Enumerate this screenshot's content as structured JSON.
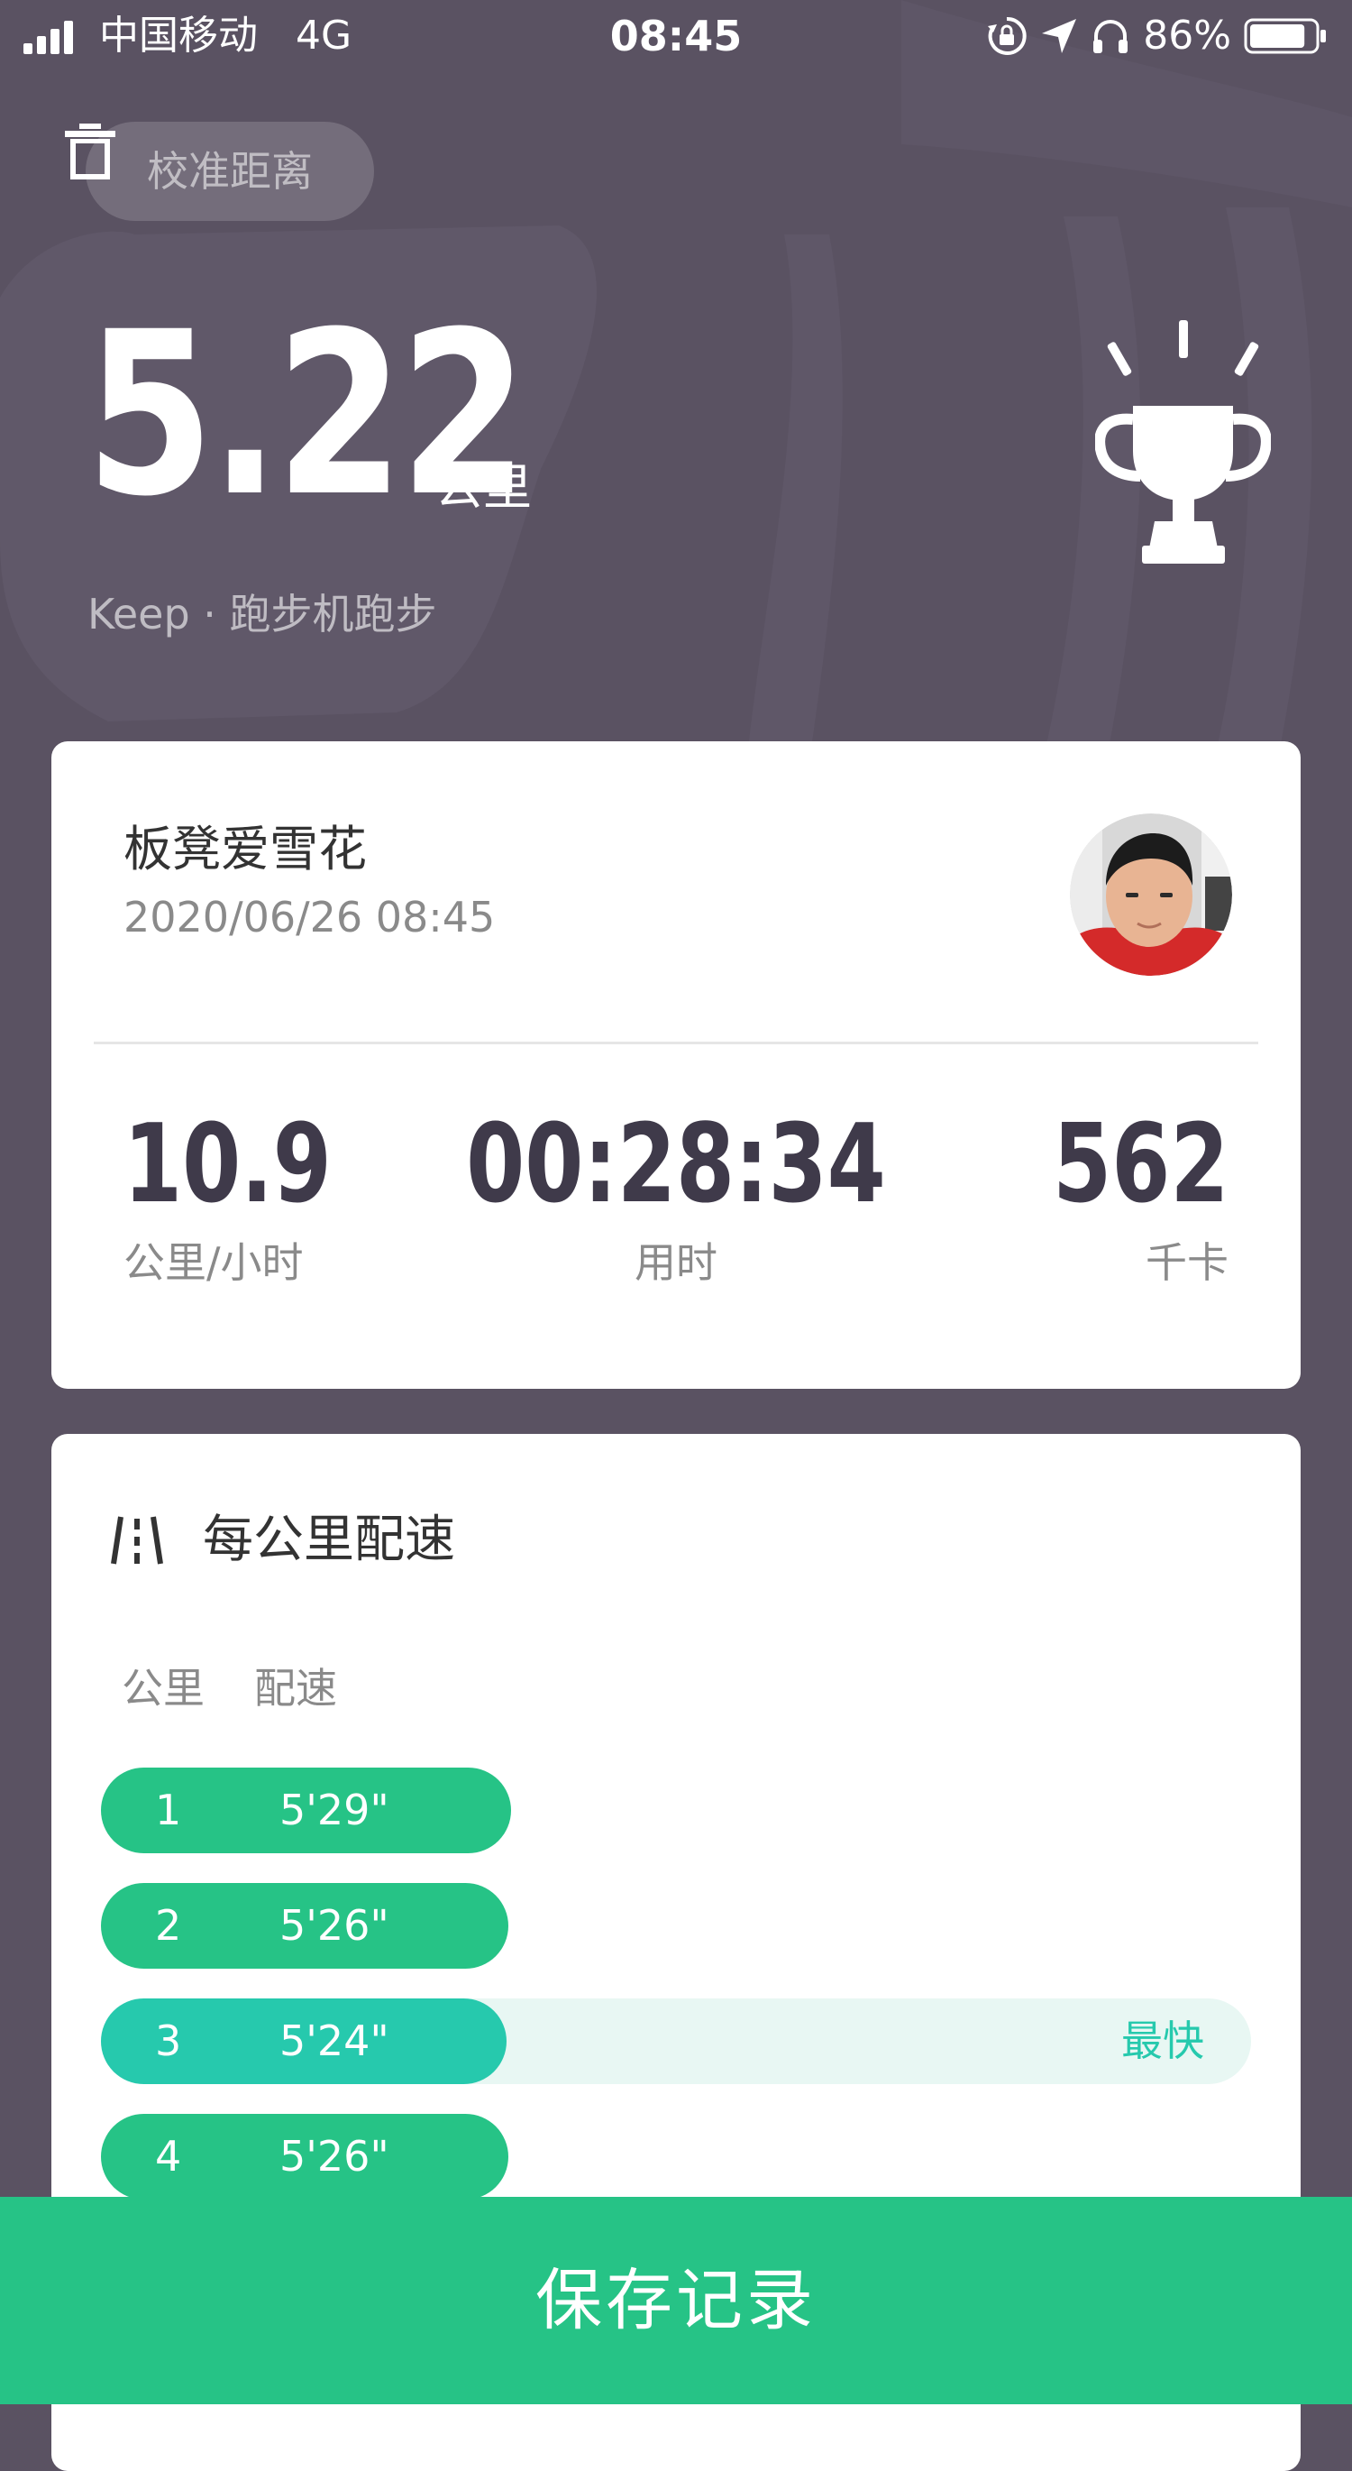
{
  "status_bar": {
    "carrier": "中国移动",
    "network": "4G",
    "time": "08:45",
    "battery": "86%",
    "battery_level": 0.86
  },
  "header": {
    "calibrate_label": "校准距离",
    "distance_value": "5.22",
    "distance_unit": "公里",
    "subtitle": "Keep · 跑步机跑步"
  },
  "summary_card": {
    "username": "板凳爱雪花",
    "datetime": "2020/06/26 08:45",
    "stats": [
      {
        "value": "10.9",
        "label": "公里/小时"
      },
      {
        "value": "00:28:34",
        "label": "用时"
      },
      {
        "value": "562",
        "label": "千卡"
      }
    ]
  },
  "pace_card": {
    "title": "每公里配速",
    "col_km": "公里",
    "col_pace": "配速",
    "fastest_label": "最快",
    "rows": [
      {
        "km": "1",
        "pace": "5'29\"",
        "fastest": false
      },
      {
        "km": "2",
        "pace": "5'26\"",
        "fastest": false
      },
      {
        "km": "3",
        "pace": "5'24\"",
        "fastest": true
      },
      {
        "km": "4",
        "pace": "5'26\"",
        "fastest": false
      }
    ]
  },
  "footer": {
    "save_label": "保存记录"
  },
  "colors": {
    "background": "#5a5262",
    "accent_green": "#26c386",
    "fastest_teal": "#26c9ad"
  }
}
